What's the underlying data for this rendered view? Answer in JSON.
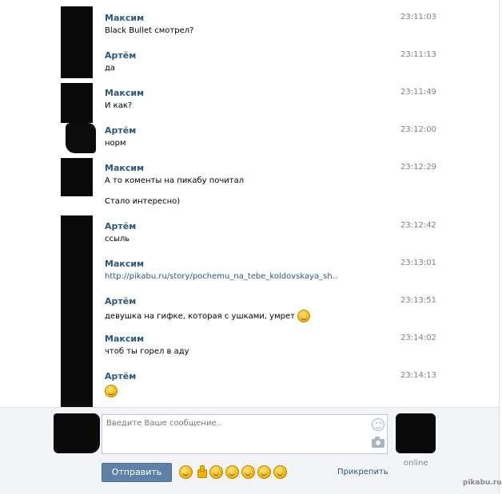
{
  "messages": [
    {
      "name": "Максим",
      "time": "23:11:03",
      "text": "Black Bullet смотрел?"
    },
    {
      "name": "Артём",
      "time": "23:11:13",
      "text": "да"
    },
    {
      "name": "Максим",
      "time": "23:11:49",
      "text": "И как?"
    },
    {
      "name": "Артём",
      "time": "23:12:00",
      "text": "норм"
    },
    {
      "name": "Максим",
      "time": "23:12:29",
      "text": "А то коменты на пикабу почитал",
      "text2": "Стало интересно)"
    },
    {
      "name": "Артём",
      "time": "23:12:42",
      "text": "ссыль"
    },
    {
      "name": "Максим",
      "time": "23:13:01",
      "text": "http://pikabu.ru/story/pochemu_na_tebe_koldovskaya_sh.."
    },
    {
      "name": "Артём",
      "time": "23:13:51",
      "text": "девушка на гифке, которая с ушками, умрет"
    },
    {
      "name": "Максим",
      "time": "23:14:02",
      "text": "чтоб ты горел в аду"
    },
    {
      "name": "Артём",
      "time": "23:14:13",
      "text": ""
    }
  ],
  "compose": {
    "placeholder": "Введите Ваше сообщение..",
    "send_label": "Отправить",
    "attach_label": "Прикрепить",
    "online_label": "online"
  },
  "watermark": "pikabu.ru",
  "colors": {
    "name": "#2b587a",
    "time": "#7f7f7f",
    "send_button": "#5e81a8"
  }
}
